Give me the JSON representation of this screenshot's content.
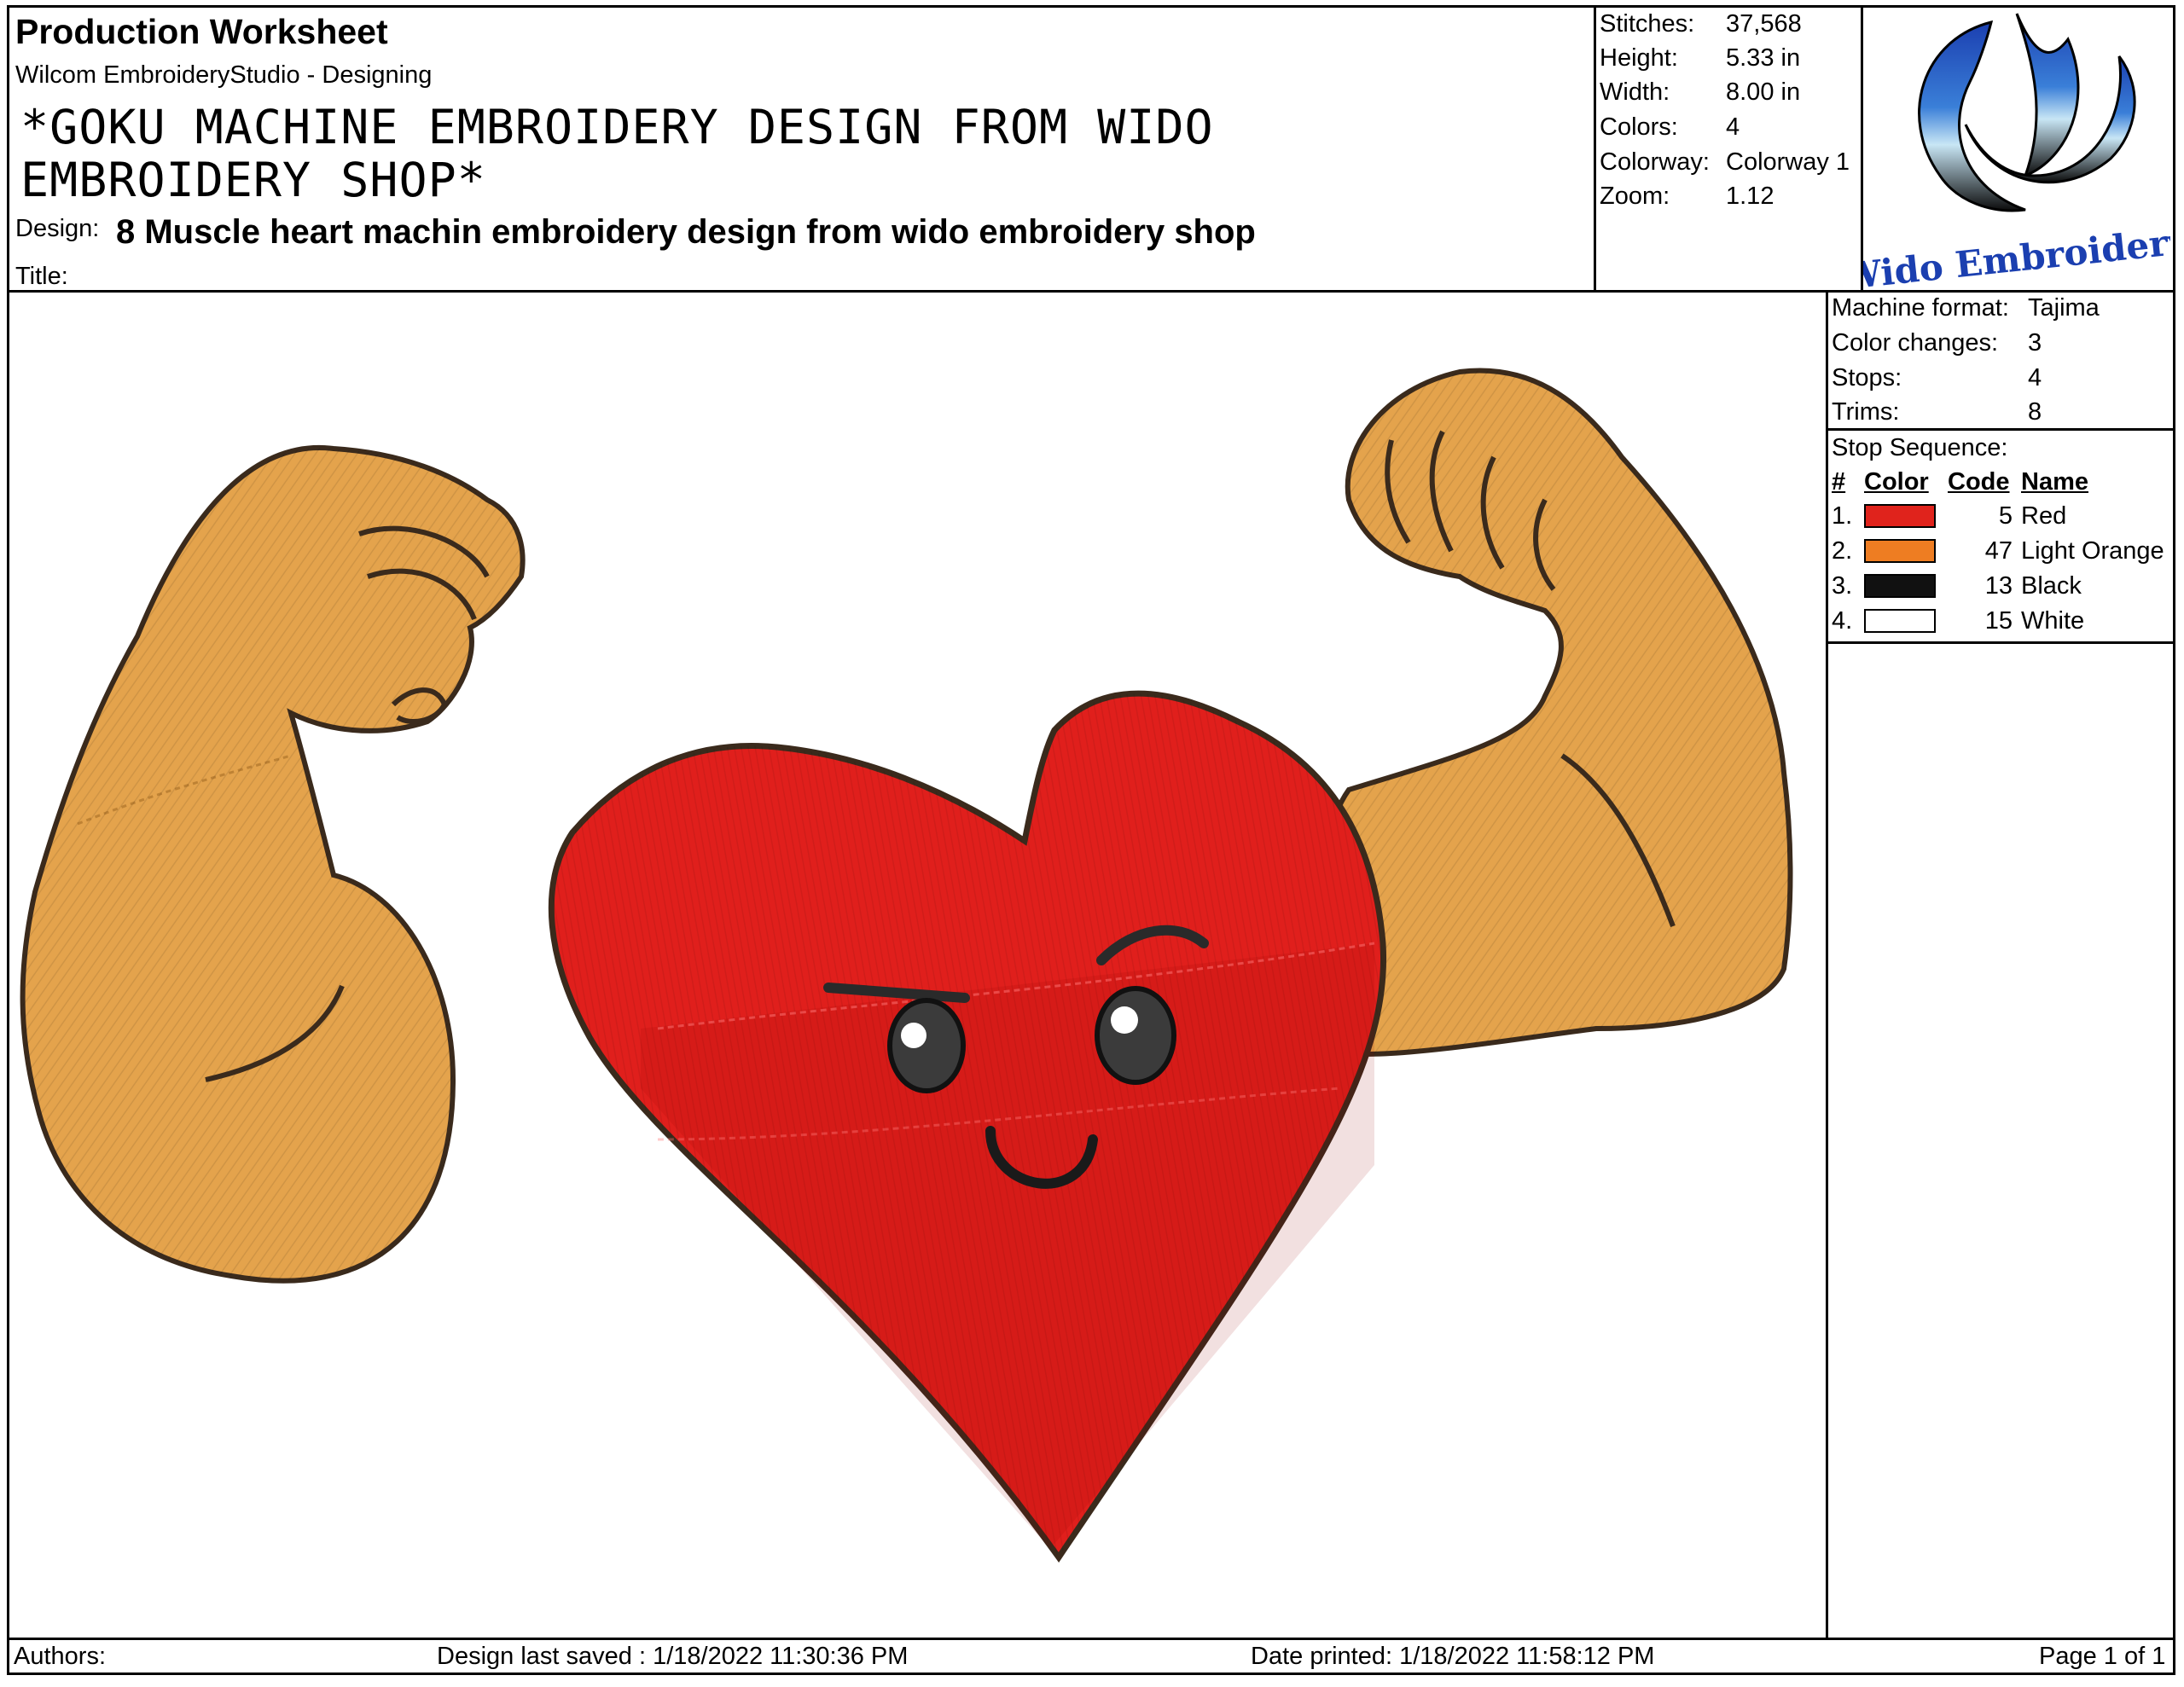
{
  "header": {
    "sheet_title": "Production Worksheet",
    "app_line": "Wilcom EmbroideryStudio - Designing",
    "big_title": "*GOKU MACHINE EMBROIDERY DESIGN FROM WIDO EMBROIDERY SHOP*",
    "design_label": "Design:",
    "design_value": "8 Muscle heart machin embroidery design from wido embroidery shop",
    "title_label": "Title:"
  },
  "stats": {
    "stitches_label": "Stitches:",
    "stitches": "37,568",
    "height_label": "Height:",
    "height": "5.33 in",
    "width_label": "Width:",
    "width": "8.00 in",
    "colors_label": "Colors:",
    "colors": "4",
    "colorway_label": "Colorway:",
    "colorway": "Colorway 1",
    "zoom_label": "Zoom:",
    "zoom": "1.12"
  },
  "logo": {
    "text": "Wido Embroidery"
  },
  "machine": {
    "format_label": "Machine format:",
    "format": "Tajima",
    "changes_label": "Color changes:",
    "changes": "3",
    "stops_label": "Stops:",
    "stops": "4",
    "trims_label": "Trims:",
    "trims": "8"
  },
  "stop_sequence": {
    "label": "Stop Sequence:",
    "headers": {
      "num": "#",
      "color": "Color",
      "code": "Code",
      "name": "Name"
    },
    "rows": [
      {
        "num": "1.",
        "color": "#e0231c",
        "code": "5",
        "name": "Red"
      },
      {
        "num": "2.",
        "color": "#ee7d22",
        "code": "47",
        "name": "Light Orange"
      },
      {
        "num": "3.",
        "color": "#111111",
        "code": "13",
        "name": "Black"
      },
      {
        "num": "4.",
        "color": "#ffffff",
        "code": "15",
        "name": "White"
      }
    ]
  },
  "footer": {
    "authors": "Authors:",
    "saved": "Design last saved : 1/18/2022 11:30:36 PM",
    "printed": "Date printed: 1/18/2022 11:58:12 PM",
    "page": "Page 1 of 1"
  },
  "palette": {
    "skin": "#e4a34c",
    "heart": "#e01f1c",
    "heart_dark": "#c9140f",
    "outline": "#3a2a1c"
  }
}
